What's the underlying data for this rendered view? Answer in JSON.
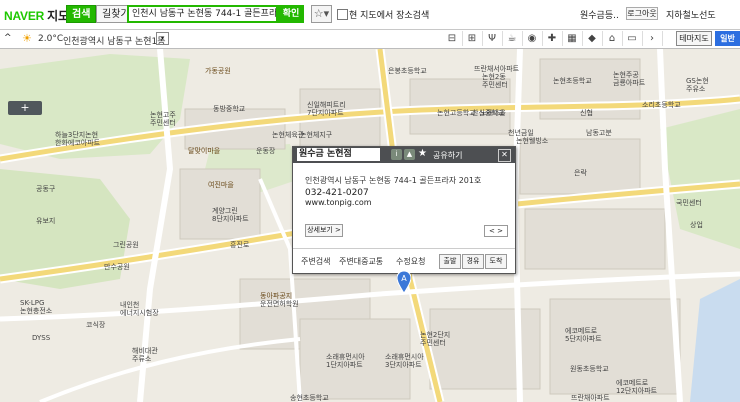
{
  "topbar": {
    "logo": "NAVER",
    "service": "지도",
    "tabs": [
      "검색",
      "길찾기"
    ],
    "search_value": "인천시 남동구 논현동 744-1 골든프라자",
    "search_button": "확인",
    "favorites_icon": "star-icon",
    "checkbox_label": "현 지도에서 장소검색",
    "user": "원수금등..",
    "logout": "로그아웃",
    "help": "지하철노선도"
  },
  "subbar": {
    "toggle": "^",
    "weather_icon": "partly-cloudy-icon",
    "temperature": "2.0°C",
    "location": "인천광역시 남동구 논현1동",
    "categories": [
      "bus-icon",
      "subway-icon",
      "restaurant-icon",
      "cafe-icon",
      "movie-icon",
      "hospital-icon",
      "bank-icon",
      "shopping-icon",
      "parking-icon",
      "car-icon",
      "next-icon"
    ],
    "theme_button": "테마지도",
    "normal_button": "일반"
  },
  "map": {
    "zoom_label": "+",
    "labels": [
      {
        "t": "가동공원",
        "c": "br"
      },
      {
        "t": "논현고주",
        "c": ""
      },
      {
        "t": "주민센터",
        "c": ""
      },
      {
        "t": "동방중학교",
        "c": ""
      },
      {
        "t": "신일해피트리",
        "c": ""
      },
      {
        "t": "7단지아파트",
        "c": ""
      },
      {
        "t": "하늘3단지논현",
        "c": ""
      },
      {
        "t": "한화에코아파트",
        "c": ""
      },
      {
        "t": "논현체육관",
        "c": ""
      },
      {
        "t": "논현체지구",
        "c": ""
      },
      {
        "t": "달맞이마을",
        "c": "br"
      },
      {
        "t": "운동장",
        "c": ""
      },
      {
        "t": "여진마을",
        "c": "br"
      },
      {
        "t": "계양그린",
        "c": ""
      },
      {
        "t": "8단지아파트",
        "c": ""
      },
      {
        "t": "공동구",
        "c": ""
      },
      {
        "t": "유보지",
        "c": ""
      },
      {
        "t": "그린공원",
        "c": ""
      },
      {
        "t": "만수공원",
        "c": ""
      },
      {
        "t": "흥진로",
        "c": ""
      },
      {
        "t": "동아파공지",
        "c": "br"
      },
      {
        "t": "운전면허학원",
        "c": ""
      },
      {
        "t": "내인천",
        "c": ""
      },
      {
        "t": "에너지시험장",
        "c": ""
      },
      {
        "t": "SK-LPG",
        "c": ""
      },
      {
        "t": "논현충전소",
        "c": ""
      },
      {
        "t": "코식장",
        "c": ""
      },
      {
        "t": "DYSS",
        "c": ""
      },
      {
        "t": "해비대관",
        "c": ""
      },
      {
        "t": "주류소",
        "c": ""
      },
      {
        "t": "은봉초등학교",
        "c": ""
      },
      {
        "t": "뜨란채서아파트",
        "c": ""
      },
      {
        "t": "논현2동",
        "c": ""
      },
      {
        "t": "주민센터",
        "c": ""
      },
      {
        "t": "논현초등학교",
        "c": ""
      },
      {
        "t": "논현주공",
        "c": ""
      },
      {
        "t": "금룡아파트",
        "c": ""
      },
      {
        "t": "GS논현",
        "c": ""
      },
      {
        "t": "주유소",
        "c": ""
      },
      {
        "t": "소리초등학교",
        "c": ""
      },
      {
        "t": "논현고등학교",
        "c": ""
      },
      {
        "t": "한신중학교",
        "c": ""
      },
      {
        "t": "신협",
        "c": ""
      },
      {
        "t": "남동고분",
        "c": ""
      },
      {
        "t": "천년금일",
        "c": ""
      },
      {
        "t": "논현웰빙소",
        "c": ""
      },
      {
        "t": "은락",
        "c": ""
      },
      {
        "t": "국민센터",
        "c": ""
      },
      {
        "t": "상업",
        "c": ""
      },
      {
        "t": "논현2단지",
        "c": ""
      },
      {
        "t": "주민센터",
        "c": ""
      },
      {
        "t": "소래휴먼시아",
        "c": ""
      },
      {
        "t": "1단지아파트",
        "c": ""
      },
      {
        "t": "소래휴먼시아",
        "c": ""
      },
      {
        "t": "3단지아파트",
        "c": ""
      },
      {
        "t": "에코메트로",
        "c": ""
      },
      {
        "t": "5단지아파트",
        "c": ""
      },
      {
        "t": "원동초등학교",
        "c": ""
      },
      {
        "t": "에코메트로",
        "c": ""
      },
      {
        "t": "12단지아파트",
        "c": ""
      },
      {
        "t": "송현초등학교",
        "c": ""
      },
      {
        "t": "뜨란채아파트",
        "c": ""
      },
      {
        "t": "노래마을",
        "c": ""
      }
    ]
  },
  "popup": {
    "title": "원수금 논현점",
    "favorite_icon": "star-icon",
    "share": "공유하기",
    "close_icon": "close-icon",
    "address": "인천광역시 남동구 논현동 744-1 골든프라자 201호",
    "phone": "032-421-0207",
    "website": "www.tonpig.com",
    "detail_button": "상세보기 >",
    "pager": "< >",
    "footer_links": [
      "주변검색",
      "주변대중교통",
      "수정요청"
    ],
    "route_buttons": [
      "출발",
      "경유",
      "도착"
    ]
  },
  "marker": {
    "label": "A",
    "color": "#3c78d8"
  }
}
